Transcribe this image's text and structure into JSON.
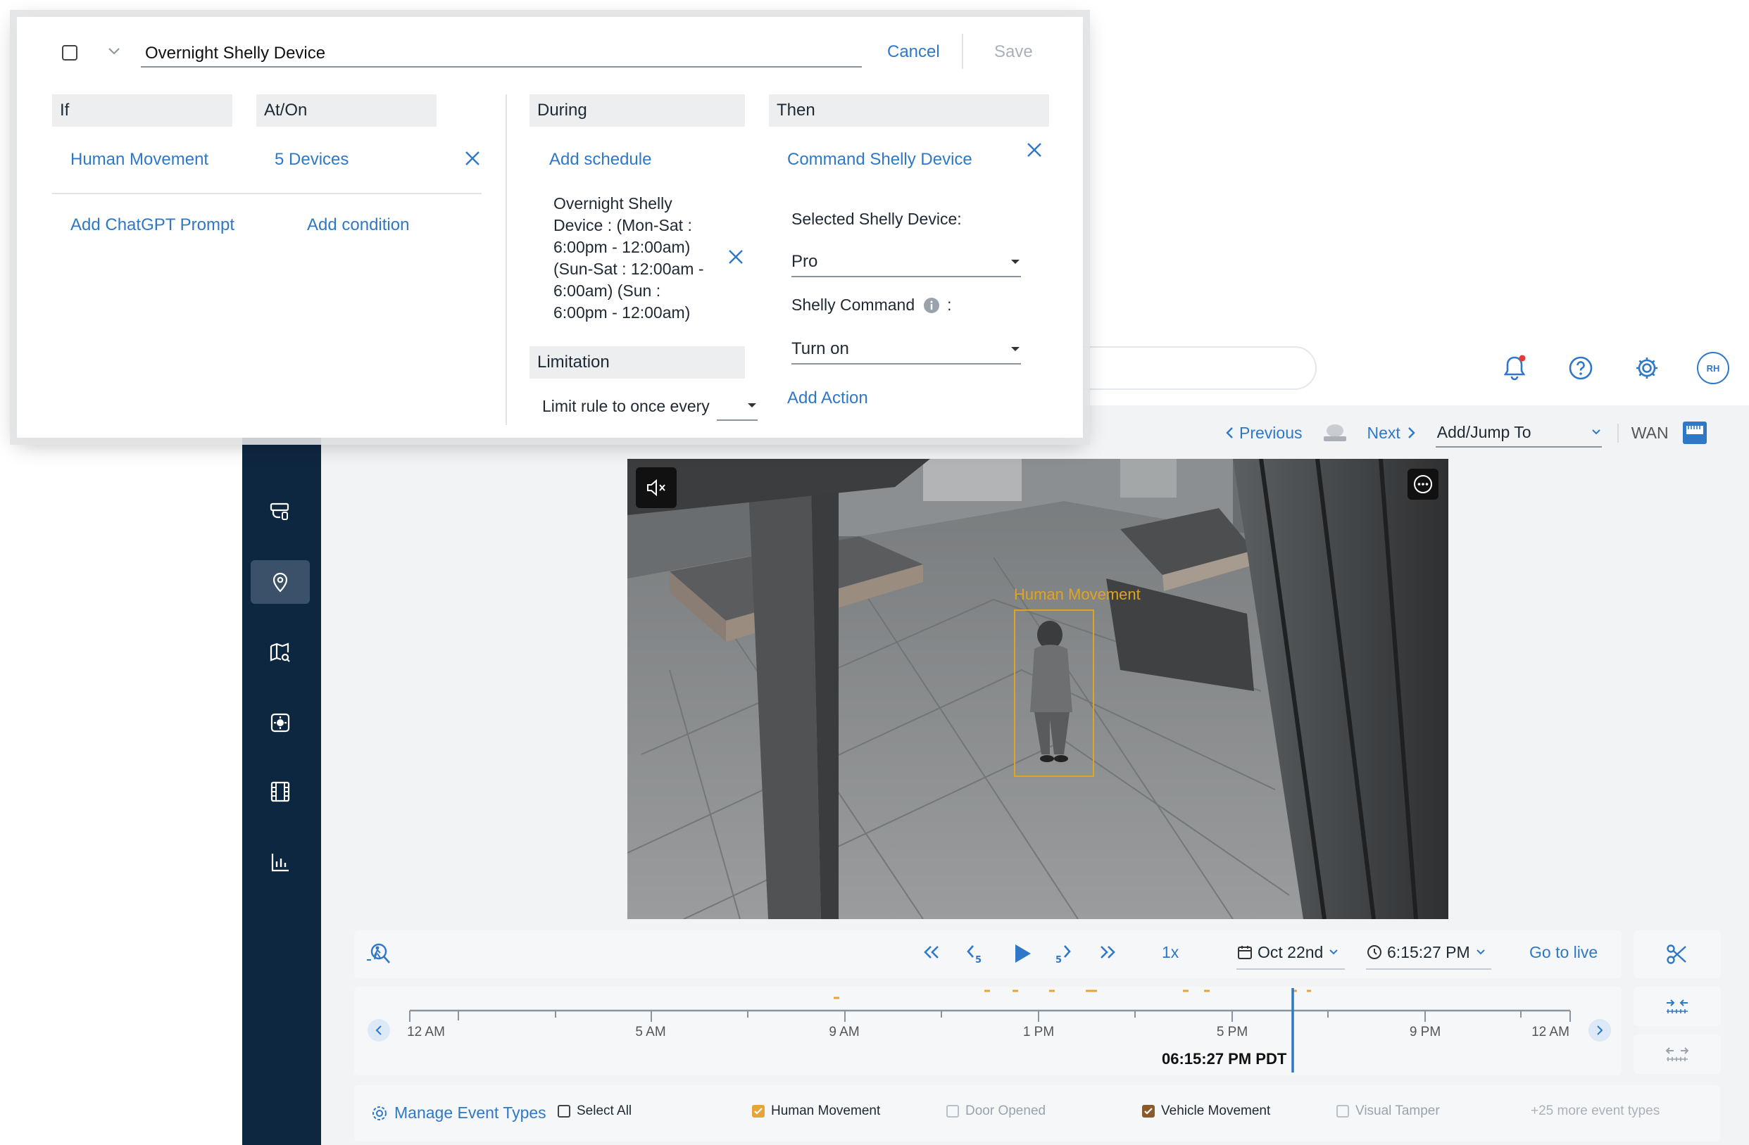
{
  "rule": {
    "name": "Overnight Shelly Device",
    "cancel_label": "Cancel",
    "save_label": "Save",
    "if": {
      "header": "If",
      "trigger": "Human Movement",
      "add_prompt": "Add ChatGPT Prompt"
    },
    "at_on": {
      "header": "At/On",
      "devices": "5 Devices",
      "add_condition": "Add condition"
    },
    "during": {
      "header": "During",
      "add_schedule": "Add schedule",
      "schedule_lines": [
        "Overnight Shelly",
        "Device : (Mon-Sat :",
        "6:00pm - 12:00am)",
        "(Sun-Sat : 12:00am -",
        "6:00am) (Sun :",
        "6:00pm - 12:00am)"
      ]
    },
    "limitation": {
      "header": "Limitation",
      "limit_label": "Limit rule to once every"
    },
    "then": {
      "header": "Then",
      "action": "Command Shelly Device",
      "device_label": "Selected Shelly Device:",
      "device_value": "Pro",
      "command_label": "Shelly Command",
      "command_colon": ":",
      "command_value": "Turn on",
      "add_action": "Add Action"
    }
  },
  "header": {
    "icons": [
      "bell-icon",
      "help-icon",
      "settings-icon"
    ],
    "avatar_initials": "RH"
  },
  "sidebar": {
    "items": [
      {
        "name": "cameras",
        "icon": "camera-icon",
        "active": false
      },
      {
        "name": "locations",
        "icon": "location-pin-icon",
        "active": true
      },
      {
        "name": "map-search",
        "icon": "map-search-icon",
        "active": false
      },
      {
        "name": "devices",
        "icon": "device-icon",
        "active": false
      },
      {
        "name": "clips",
        "icon": "film-icon",
        "active": false
      },
      {
        "name": "analytics",
        "icon": "chart-icon",
        "active": false
      }
    ]
  },
  "camera_toolbar": {
    "previous": "Previous",
    "next": "Next",
    "jump_to": "Add/Jump To",
    "wan": "WAN"
  },
  "camera": {
    "detection_label": "Human Movement"
  },
  "playback": {
    "speed": "1x",
    "date": "Oct 22nd",
    "time": "6:15:27 PM",
    "go_live": "Go to live"
  },
  "timeline": {
    "labels": [
      "12 AM",
      "5 AM",
      "9 AM",
      "1 PM",
      "5 PM",
      "9 PM",
      "12 AM"
    ],
    "cursor_time": "06:15:27 PM PDT"
  },
  "events": {
    "manage": "Manage Event Types",
    "select_all": "Select All",
    "types": [
      {
        "label": "Human Movement",
        "checked": true,
        "enabled": true
      },
      {
        "label": "Door Opened",
        "checked": false,
        "enabled": false
      },
      {
        "label": "Vehicle Movement",
        "checked": true,
        "enabled": true
      },
      {
        "label": "Visual Tamper",
        "checked": false,
        "enabled": false
      }
    ],
    "more": "+25 more event types"
  },
  "colors": {
    "accent": "#2f78c8",
    "sidebar": "#0e2740",
    "detection": "#e0a520",
    "vehicle_check": "#8a5a2b",
    "timeline_cursor": "#2f78c8",
    "notification_dot": "#e53935"
  }
}
